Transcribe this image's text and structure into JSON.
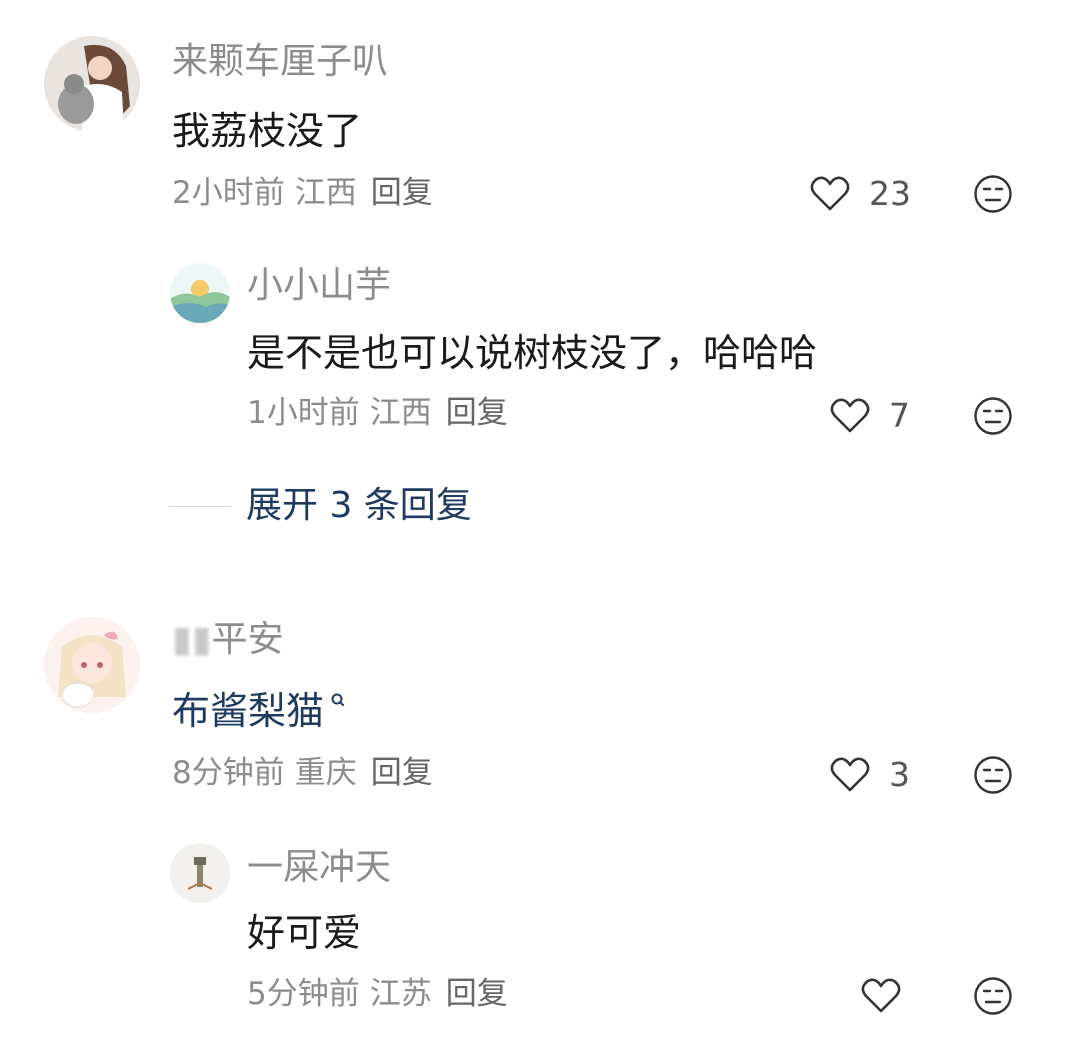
{
  "comments": [
    {
      "name": "来颗车厘子叭",
      "text": "我荔枝没了",
      "time": "2小时前",
      "location": "江西",
      "reply_label": "回复",
      "likes": "23",
      "replies": [
        {
          "name": "小小山芋",
          "text": "是不是也可以说树枝没了，哈哈哈",
          "time": "1小时前",
          "location": "江西",
          "reply_label": "回复",
          "likes": "7"
        }
      ],
      "expand_label": "展开 3 条回复"
    },
    {
      "name_visible": "平安",
      "text": "布酱梨猫",
      "time": "8分钟前",
      "location": "重庆",
      "reply_label": "回复",
      "likes": "3",
      "replies": [
        {
          "name": "一屎冲天",
          "text": "好可爱",
          "time": "5分钟前",
          "location": "江苏",
          "reply_label": "回复",
          "likes": ""
        }
      ]
    }
  ],
  "icons": {
    "like": "heart-outline-icon",
    "emoji": "neutral-face-icon",
    "search": "search-icon"
  },
  "colors": {
    "link": "#1f3a5f",
    "meta": "#8c8c8c"
  }
}
